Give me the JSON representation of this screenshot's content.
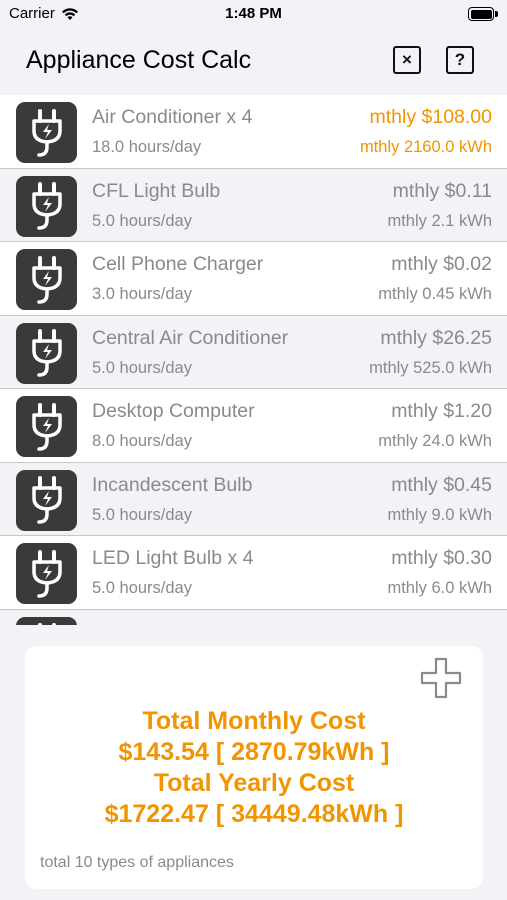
{
  "status_bar": {
    "carrier": "Carrier",
    "time": "1:48 PM"
  },
  "nav": {
    "title": "Appliance Cost Calc",
    "close_icon": "×",
    "help_icon": "?"
  },
  "appliances": [
    {
      "name": "Air Conditioner x 4",
      "hours": "18.0 hours/day",
      "cost": "mthly $108.00",
      "kwh": "mthly 2160.0 kWh"
    },
    {
      "name": "CFL Light Bulb",
      "hours": "5.0 hours/day",
      "cost": "mthly $0.11",
      "kwh": "mthly 2.1 kWh"
    },
    {
      "name": "Cell Phone Charger",
      "hours": "3.0 hours/day",
      "cost": "mthly $0.02",
      "kwh": "mthly 0.45 kWh"
    },
    {
      "name": "Central Air Conditioner",
      "hours": "5.0 hours/day",
      "cost": "mthly $26.25",
      "kwh": "mthly 525.0 kWh"
    },
    {
      "name": "Desktop Computer",
      "hours": "8.0 hours/day",
      "cost": "mthly $1.20",
      "kwh": "mthly 24.0 kWh"
    },
    {
      "name": "Incandescent Bulb",
      "hours": "5.0 hours/day",
      "cost": "mthly $0.45",
      "kwh": "mthly 9.0 kWh"
    },
    {
      "name": "LED Light Bulb x 4",
      "hours": "5.0 hours/day",
      "cost": "mthly $0.30",
      "kwh": "mthly 6.0 kWh"
    }
  ],
  "summary": {
    "monthly_label": "Total Monthly Cost",
    "monthly_value": "$143.54 [ 2870.79kWh ]",
    "yearly_label": "Total Yearly Cost",
    "yearly_value": "$1722.47 [ 34449.48kWh ]",
    "footnote": "total 10 types of appliances"
  },
  "colors": {
    "accent": "#f29400",
    "row_alt": "#f2f2f7",
    "icon_bg": "#3a3a3a",
    "text_gray": "#8a8a8e"
  },
  "icons": {
    "appliance": "plug-bolt-icon",
    "add": "plus-icon",
    "close": "close-icon",
    "help": "help-icon"
  }
}
